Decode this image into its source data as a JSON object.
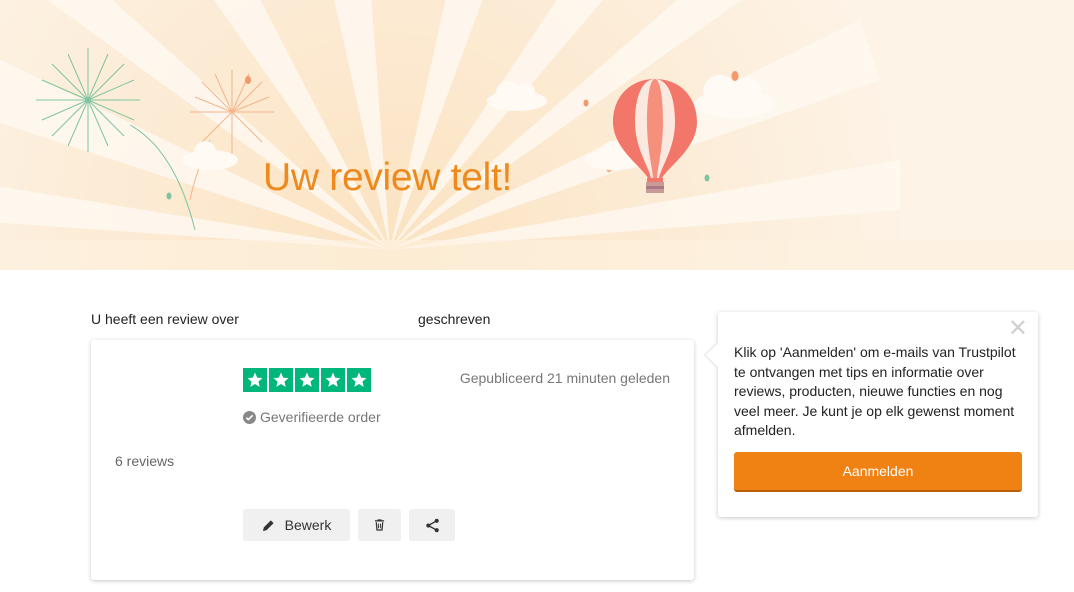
{
  "hero": {
    "title": "Uw review telt!"
  },
  "intro": {
    "prefix": "U heeft een review over",
    "suffix": "geschreven"
  },
  "review": {
    "rating": 5,
    "max_rating": 5,
    "published": "Gepubliceerd 21 minuten geleden",
    "verified": "Geverifieerde order",
    "reviews_count": "6 reviews",
    "actions": {
      "edit_label": "Bewerk",
      "delete_icon": "trash-icon",
      "share_icon": "share-icon"
    }
  },
  "popover": {
    "text": "Klik op 'Aanmelden' om e-mails van Trustpilot te ontvangen met tips en informatie over reviews, producten, nieuwe functies en nog veel meer. Je kunt je op elk gewenst moment afmelden.",
    "button": "Aanmelden",
    "close_icon": "close-icon"
  },
  "colors": {
    "accent": "#f08214",
    "title": "#ee8a1d",
    "star": "#00b67a",
    "hero_bg": "#fdf1df"
  }
}
